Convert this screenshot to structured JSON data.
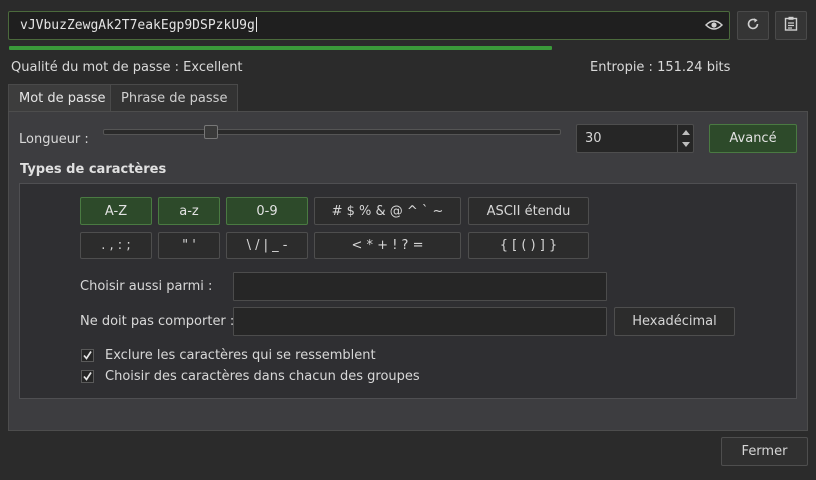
{
  "password": {
    "value": "vJVbuzZewgAk2T7eakEgp9DSPzkU9g",
    "strength_fraction": 1.0
  },
  "icons": {
    "show_password": "eye-icon",
    "regenerate": "refresh-icon",
    "copy": "clipboard-icon"
  },
  "quality": {
    "label": "Qualité du mot de passe  : Excellent"
  },
  "entropy": {
    "label": "Entropie  : 151.24  bits"
  },
  "tabs": [
    {
      "label": "Mot de passe",
      "active": true
    },
    {
      "label": "Phrase de passe",
      "active": false
    }
  ],
  "length": {
    "label": "Longueur  :",
    "value": "30"
  },
  "advanced_button": "Avancé",
  "char_types": {
    "heading": "Types de caractères",
    "row1": [
      {
        "label": "A-Z",
        "on": true
      },
      {
        "label": "a-z",
        "on": true
      },
      {
        "label": "0-9",
        "on": true
      },
      {
        "label": "# $ % & @ ^ ` ~",
        "on": false
      },
      {
        "label": "ASCII étendu",
        "on": false
      }
    ],
    "row2": [
      {
        "label": ". , : ;",
        "on": false
      },
      {
        "label": "\" '",
        "on": false
      },
      {
        "label": "\\ / | _ -",
        "on": false
      },
      {
        "label": "< * + ! ? =",
        "on": false
      },
      {
        "label": "{ [ ( ) ] }",
        "on": false
      }
    ]
  },
  "also_choose": {
    "label": "Choisir aussi parmi  :",
    "value": ""
  },
  "exclude": {
    "label": "Ne doit pas comporter  :",
    "value": "",
    "hex_button": "Hexadécimal"
  },
  "options": [
    {
      "label": "Exclure les caractères qui se ressemblent",
      "checked": true
    },
    {
      "label": "Choisir des caractères dans chacun des groupes",
      "checked": true
    }
  ],
  "close_button": "Fermer",
  "colors": {
    "accent_green": "#3a9a3a",
    "toggle_on": "#2d4a2a"
  }
}
